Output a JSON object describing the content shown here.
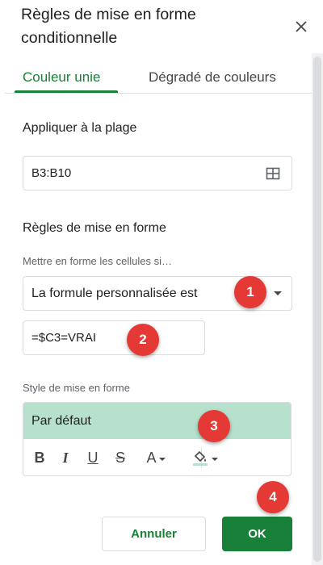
{
  "dialog": {
    "title": "Règles de mise en forme conditionnelle",
    "close_icon": "close-icon"
  },
  "tabs": [
    {
      "label": "Couleur unie",
      "active": true
    },
    {
      "label": "Dégradé de couleurs",
      "active": false
    }
  ],
  "range": {
    "label": "Appliquer à la plage",
    "value": "B3:B10",
    "icon": "grid-select-icon"
  },
  "rules": {
    "label": "Règles de mise en forme",
    "condition_label": "Mettre en forme les cellules si…",
    "condition_value": "La formule personnalisée est",
    "formula_value": "=$C3=VRAI"
  },
  "style": {
    "label": "Style de mise en forme",
    "preview_text": "Par défaut",
    "preview_bg": "#b7e1cd",
    "tools": [
      "bold-icon",
      "italic-icon",
      "underline-icon",
      "strikethrough-icon",
      "text-color-icon",
      "fill-color-icon"
    ]
  },
  "badges": [
    "1",
    "2",
    "3",
    "4"
  ],
  "buttons": {
    "cancel": "Annuler",
    "ok": "OK"
  },
  "colors": {
    "accent": "#188038",
    "badge": "#e53935"
  }
}
